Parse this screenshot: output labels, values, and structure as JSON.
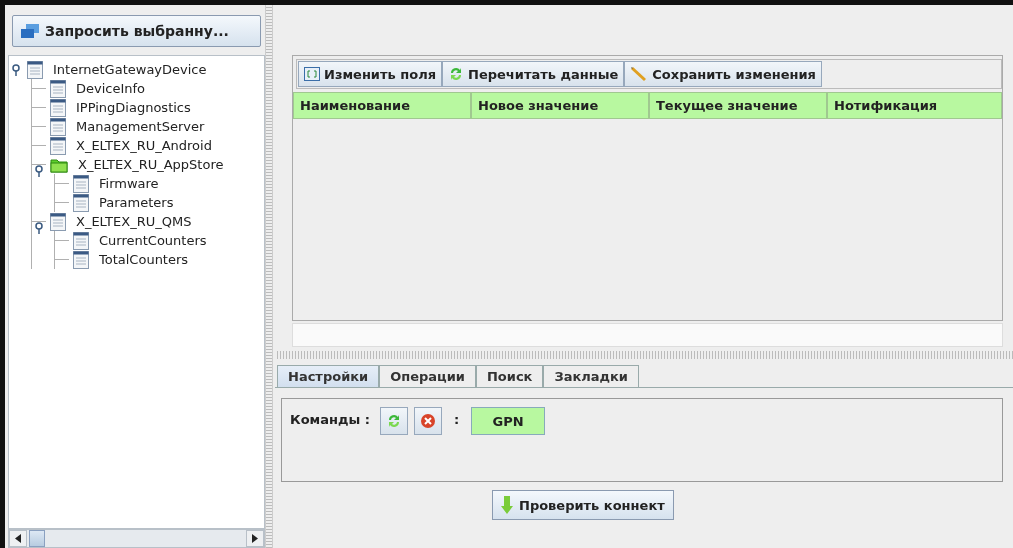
{
  "left_panel": {
    "request_button": "Запросить выбранну...",
    "tree": [
      {
        "label": "InternetGatewayDevice",
        "kind": "table",
        "expanded": true,
        "children": [
          {
            "label": "DeviceInfo",
            "kind": "table"
          },
          {
            "label": "IPPingDiagnostics",
            "kind": "table"
          },
          {
            "label": "ManagementServer",
            "kind": "table"
          },
          {
            "label": "X_ELTEX_RU_Android",
            "kind": "table"
          },
          {
            "label": "X_ELTEX_RU_AppStore",
            "kind": "folder",
            "expanded": true,
            "children": [
              {
                "label": "Firmware",
                "kind": "table"
              },
              {
                "label": "Parameters",
                "kind": "table"
              }
            ]
          },
          {
            "label": "X_ELTEX_RU_QMS",
            "kind": "table",
            "expanded": true,
            "children": [
              {
                "label": "CurrentCounters",
                "kind": "table"
              },
              {
                "label": "TotalCounters",
                "kind": "table"
              }
            ]
          }
        ]
      }
    ]
  },
  "toolbar": [
    {
      "label": "Изменить поля",
      "kind": "edit"
    },
    {
      "label": "Перечитать данные",
      "kind": "refresh"
    },
    {
      "label": "Сохранить изменения",
      "kind": "pencil"
    }
  ],
  "table": {
    "columns": [
      "Наименование",
      "Новое значение",
      "Текущее значение",
      "Нотификация"
    ]
  },
  "tabs": [
    {
      "label": "Настройки",
      "selected": true
    },
    {
      "label": "Операции",
      "selected": false
    },
    {
      "label": "Поиск",
      "selected": false
    },
    {
      "label": "Закладки",
      "selected": false
    }
  ],
  "commands": {
    "label": "Команды :",
    "separator": ":",
    "value": "GPN"
  },
  "check_button": "Проверить коннект"
}
